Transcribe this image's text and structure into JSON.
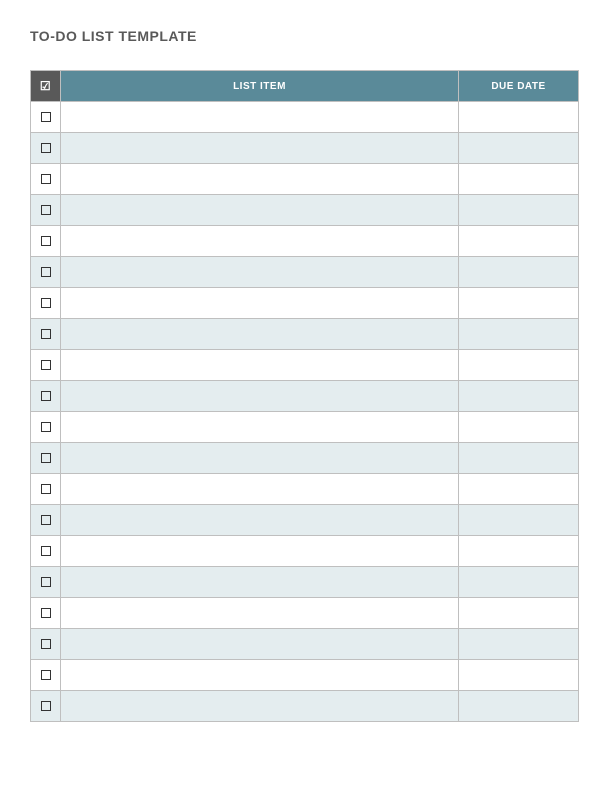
{
  "title": "TO-DO LIST TEMPLATE",
  "headers": {
    "check": "☑",
    "item": "LIST ITEM",
    "due": "DUE DATE"
  },
  "colors": {
    "header_check_bg": "#595959",
    "header_item_bg": "#5a8a99",
    "alt_row_bg": "#e4edef",
    "border": "#bfbfbf"
  },
  "rows": [
    {
      "checked": false,
      "item": "",
      "due": ""
    },
    {
      "checked": false,
      "item": "",
      "due": ""
    },
    {
      "checked": false,
      "item": "",
      "due": ""
    },
    {
      "checked": false,
      "item": "",
      "due": ""
    },
    {
      "checked": false,
      "item": "",
      "due": ""
    },
    {
      "checked": false,
      "item": "",
      "due": ""
    },
    {
      "checked": false,
      "item": "",
      "due": ""
    },
    {
      "checked": false,
      "item": "",
      "due": ""
    },
    {
      "checked": false,
      "item": "",
      "due": ""
    },
    {
      "checked": false,
      "item": "",
      "due": ""
    },
    {
      "checked": false,
      "item": "",
      "due": ""
    },
    {
      "checked": false,
      "item": "",
      "due": ""
    },
    {
      "checked": false,
      "item": "",
      "due": ""
    },
    {
      "checked": false,
      "item": "",
      "due": ""
    },
    {
      "checked": false,
      "item": "",
      "due": ""
    },
    {
      "checked": false,
      "item": "",
      "due": ""
    },
    {
      "checked": false,
      "item": "",
      "due": ""
    },
    {
      "checked": false,
      "item": "",
      "due": ""
    },
    {
      "checked": false,
      "item": "",
      "due": ""
    },
    {
      "checked": false,
      "item": "",
      "due": ""
    }
  ]
}
